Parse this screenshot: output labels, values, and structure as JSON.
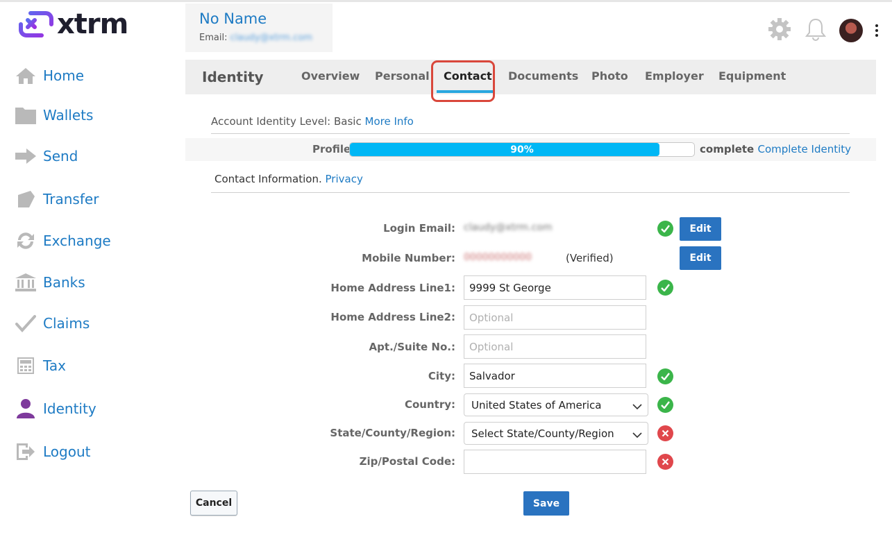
{
  "brand": {
    "name": "xtrm",
    "accent": "#7c3aed"
  },
  "sidebar": {
    "items": [
      {
        "label": "Home",
        "icon": "home-icon"
      },
      {
        "label": "Wallets",
        "icon": "folder-icon"
      },
      {
        "label": "Send",
        "icon": "arrow-right-icon"
      },
      {
        "label": "Transfer",
        "icon": "transfer-icon"
      },
      {
        "label": "Exchange",
        "icon": "exchange-icon"
      },
      {
        "label": "Banks",
        "icon": "bank-icon"
      },
      {
        "label": "Claims",
        "icon": "check-icon"
      },
      {
        "label": "Tax",
        "icon": "calculator-icon"
      },
      {
        "label": "Identity",
        "icon": "user-icon"
      },
      {
        "label": "Logout",
        "icon": "logout-icon"
      }
    ]
  },
  "header": {
    "user_name": "No Name",
    "email_label": "Email:",
    "email_value": "claudy@xtrm.com",
    "icons": [
      "gear-icon",
      "bell-icon",
      "avatar",
      "more-vertical-icon"
    ]
  },
  "tabs": {
    "title": "Identity",
    "items": [
      "Overview",
      "Personal",
      "Contact",
      "Documents",
      "Photo",
      "Employer",
      "Equipment"
    ],
    "active": "Contact"
  },
  "identity": {
    "level_text": "Account Identity Level: Basic",
    "more_info": "More Info",
    "profile_label": "Profile",
    "progress_percent": 90,
    "progress_text": "90%",
    "complete_text": "complete",
    "complete_link": "Complete Identity",
    "contact_text": "Contact Information.",
    "privacy_link": "Privacy"
  },
  "form": {
    "login_email_label": "Login Email:",
    "login_email_value": "claudy@xtrm.com",
    "mobile_label": "Mobile Number:",
    "mobile_value": "00000000000",
    "mobile_status": "(Verified)",
    "edit_label": "Edit",
    "address1_label": "Home Address Line1:",
    "address1_value": "9999 St George",
    "address2_label": "Home Address Line2:",
    "address2_placeholder": "Optional",
    "apt_label": "Apt./Suite No.:",
    "apt_placeholder": "Optional",
    "city_label": "City:",
    "city_value": "Salvador",
    "country_label": "Country:",
    "country_value": "United States of America",
    "state_label": "State/County/Region:",
    "state_value": "Select State/County/Region",
    "zip_label": "Zip/Postal Code:",
    "zip_value": ""
  },
  "actions": {
    "cancel": "Cancel",
    "save": "Save"
  }
}
